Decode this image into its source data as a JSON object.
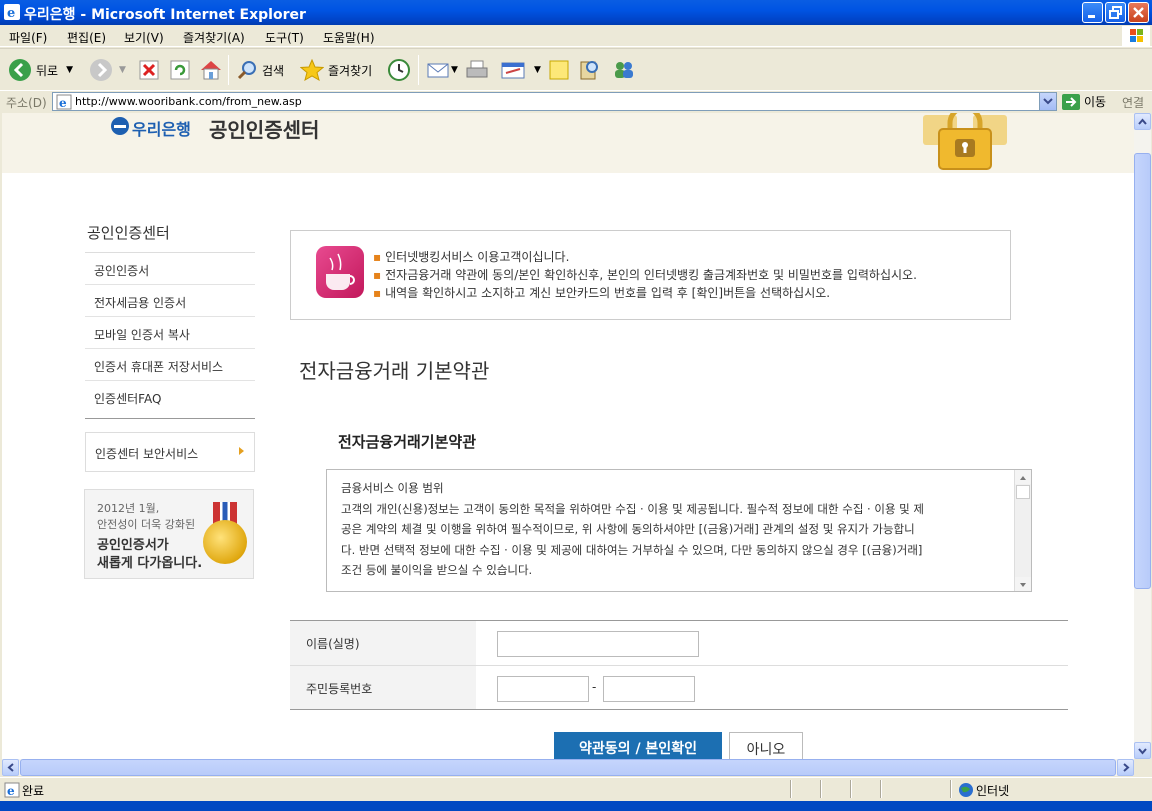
{
  "window": {
    "title": "우리은행 - Microsoft Internet Explorer"
  },
  "menu": [
    "파일(F)",
    "편집(E)",
    "보기(V)",
    "즐겨찾기(A)",
    "도구(T)",
    "도움말(H)"
  ],
  "toolbar": {
    "back_label": "뒤로",
    "search_label": "검색",
    "favorites_label": "즐겨찾기"
  },
  "address": {
    "label": "주소(D)",
    "url": "http://www.wooribank.com/from_new.asp",
    "go_label": "이동",
    "links_label": "연결"
  },
  "header": {
    "logo_text": "우리은행",
    "center_title": "공인인증센터"
  },
  "nav": {
    "title": "공인인증센터",
    "items": [
      "공인인증서",
      "전자세금용 인증서",
      "모바일 인증서 복사",
      "인증서 휴대폰 저장서비스",
      "인증센터FAQ"
    ],
    "security": "인증센터 보안서비스"
  },
  "promo": {
    "line1": "2012년 1월,",
    "line2": "안전성이 더욱 강화된",
    "line3": "공인인증서가",
    "line4": "새롭게 다가옵니다."
  },
  "info": {
    "bullet": "▪",
    "lines": [
      "인터넷뱅킹서비스 이용고객이십니다.",
      "전자금융거래 약관에 동의/본인 확인하신후, 본인의 인터넷뱅킹 출금계좌번호 및 비밀번호를 입력하십시오.",
      "내역을 확인하시고 소지하고 계신 보안카드의 번호를 입력 후 [확인]버튼을 선택하십시오."
    ]
  },
  "page_heading": "전자금융거래 기본약관",
  "terms": {
    "heading": "전자금융거래기본약관",
    "lines": [
      "금융서비스 이용 범위",
      "고객의 개인(신용)정보는 고객이 동의한 목적을 위하여만 수집 · 이용 및 제공됩니다. 필수적 정보에 대한 수집 · 이용 및 제",
      "공은 계약의 체결 및 이행을 위하여 필수적이므로, 위 사항에 동의하셔야만 [(금융)거래] 관계의 설정 및 유지가 가능합니",
      "다. 반면 선택적 정보에 대한 수집 · 이용 및 제공에 대하여는 거부하실 수 있으며, 다만 동의하지 않으실 경우 [(금융)거래]",
      "조건 등에 불이익을 받으실 수 있습니다."
    ]
  },
  "form": {
    "name_label": "이름(실명)",
    "id_label": "주민등록번호",
    "dash": "-"
  },
  "buttons": {
    "agree": "약관동의 / 본인확인",
    "no": "아니오"
  },
  "status": {
    "done": "완료",
    "zone": "인터넷"
  },
  "colors": {
    "title_bar": "#0054e3",
    "brand_blue": "#1d5fb1",
    "agree_button": "#1c6fb2",
    "bullet": "#e6831a"
  }
}
